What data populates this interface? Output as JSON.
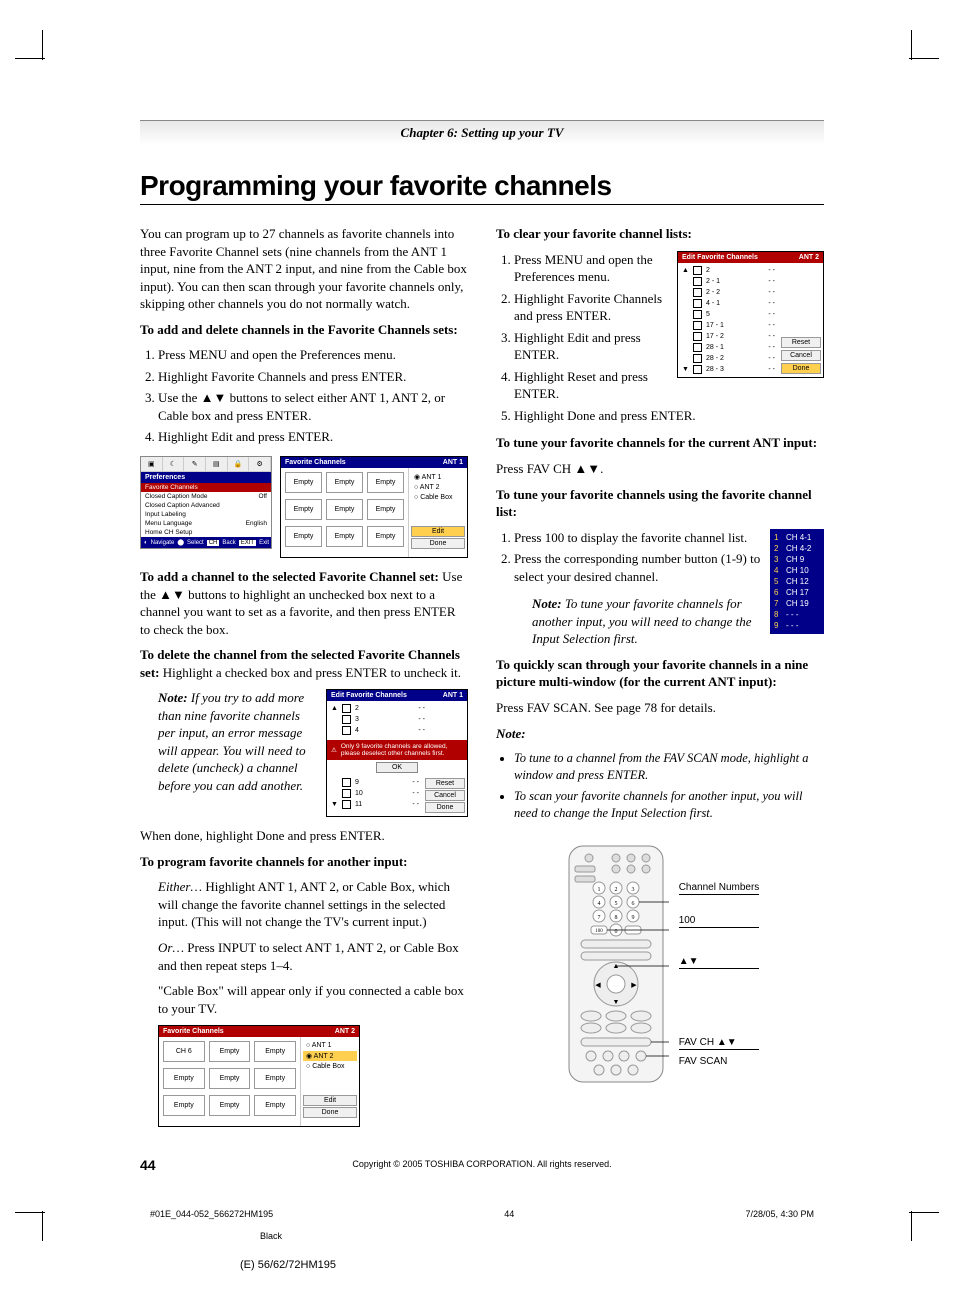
{
  "chapter": "Chapter 6: Setting up your TV",
  "title": "Programming your favorite channels",
  "intro": "You can program up to 27 channels as favorite channels into three Favorite Channel sets (nine channels from the ANT 1 input, nine from the ANT 2 input, and nine from the Cable box input). You can then scan through your favorite channels only, skipping other channels you do not normally watch.",
  "h_add_delete": "To add and delete channels in the Favorite Channels sets:",
  "steps1": {
    "s1": "Press MENU and open the Preferences menu.",
    "s2": "Highlight Favorite Channels and press ENTER.",
    "s3a": "Use the ",
    "s3b": " buttons to select either ANT 1, ANT 2, or Cable box and press ENTER.",
    "s4": "Highlight Edit and press ENTER."
  },
  "pref_panel": {
    "header": "Preferences",
    "sub": "Favorite Channels",
    "i1l": "Closed Caption Mode",
    "i1r": "Off",
    "i2": "Closed Caption Advanced",
    "i3": "Input Labeling",
    "i4l": "Menu Language",
    "i4r": "English",
    "i5": "Home CH Setup",
    "foot_nav": "Navigate",
    "foot_sel": "Select",
    "foot_back": "Back",
    "foot_exit": "Exit"
  },
  "fav_panel1": {
    "title": "Favorite Channels",
    "ant": "ANT 1",
    "empty": "Empty",
    "ant1": "ANT 1",
    "ant2": "ANT 2",
    "cable": "Cable Box",
    "edit": "Edit",
    "done": "Done"
  },
  "p_add_a": "To add a channel to the selected Favorite Channel set:",
  "p_add_b": " Use the ",
  "p_add_c": " buttons to highlight an unchecked box next to a channel you want to set as a favorite, and then press ENTER to check the box.",
  "p_del_a": "To delete the channel from the selected Favorite Channels set:",
  "p_del_b": " Highlight a checked box and press ENTER to uncheck it.",
  "note1_label": "Note:",
  "note1": " If you try to add more than nine favorite channels per input, an error message will appear. You will need to delete (uncheck) a channel before you can add another.",
  "edit_panel1": {
    "title": "Edit Favorite Channels",
    "ant": "ANT 1",
    "r1": "2",
    "r2": "3",
    "r3": "4",
    "warn": "Only 9 favorite channels are allowed, please deselect other channels first.",
    "ok": "OK",
    "r4": "9",
    "r5": "10",
    "r6": "11",
    "reset": "Reset",
    "cancel": "Cancel",
    "done": "Done",
    "dots": "- -"
  },
  "p_done": "When done, highlight Done and press ENTER.",
  "h_another": "To program favorite channels for another input:",
  "either_a": "Either…",
  "either_b": " Highlight ANT 1, ANT 2, or Cable Box, which will change the favorite channel settings in the selected input. (This will not change the TV's current input.)",
  "or_a": "Or…",
  "or_b": " Press INPUT to select ANT 1, ANT 2, or Cable Box and then repeat steps 1–4.",
  "cable_note": "\"Cable Box\" will appear only if you connected a cable box to your TV.",
  "fav_panel2": {
    "title": "Favorite Channels",
    "ant": "ANT 2",
    "ch6": "CH 6",
    "empty": "Empty",
    "ant1": "ANT 1",
    "ant2": "ANT 2",
    "cable": "Cable Box",
    "edit": "Edit",
    "done": "Done"
  },
  "h_clear": "To clear your favorite channel lists:",
  "steps2": {
    "s1": "Press MENU and open the Preferences menu.",
    "s2": "Highlight Favorite Channels and press ENTER.",
    "s3": "Highlight Edit and press ENTER.",
    "s4": "Highlight Reset and press ENTER.",
    "s5": "Highlight Done and press ENTER."
  },
  "edit_panel2": {
    "title": "Edit Favorite Channels",
    "ant": "ANT 2",
    "rows": [
      "2",
      "2 - 1",
      "2 - 2",
      "4 - 1",
      "5",
      "17 - 1",
      "17 - 2",
      "28 - 1",
      "28 - 2",
      "28 - 3"
    ],
    "dots": "- -",
    "reset": "Reset",
    "cancel": "Cancel",
    "done": "Done"
  },
  "h_tune_cur": "To tune your favorite channels for the current ANT input:",
  "p_favch_a": "Press FAV CH ",
  "p_favch_b": ".",
  "h_tune_list": "To tune your favorite channels using the favorite channel list:",
  "steps3": {
    "s1": "Press 100 to display the favorite channel list.",
    "s2": "Press the corresponding number button (1-9) to select your desired channel."
  },
  "note2_label": "Note:",
  "note2": " To tune your favorite channels for another input, you will need to change the Input Selection first.",
  "favlist": {
    "r1": "CH 4-1",
    "r2": "CH 4-2",
    "r3": "CH 9",
    "r4": "CH 10",
    "r5": "CH 12",
    "r6": "CH 17",
    "r7": "CH 19",
    "r8": "- - -",
    "r9": "- - -"
  },
  "h_scan": "To quickly scan through your favorite channels in a nine picture multi-window (for the current ANT input):",
  "p_scan": "Press FAV SCAN. See page 78 for details.",
  "note3_label": "Note:",
  "bullet1": "To tune to a channel from the FAV SCAN mode, highlight a window and press ENTER.",
  "bullet2": "To scan your favorite channels for another input, you will need to change the Input Selection first.",
  "remote": {
    "l1": "Channel Numbers",
    "l2": "100",
    "l3": "▲▼",
    "l4": "FAV CH ▲▼",
    "l5": "FAV SCAN"
  },
  "copyright": "Copyright © 2005 TOSHIBA CORPORATION. All rights reserved.",
  "pgnum": "44",
  "footfile": "#01E_044-052_566272HM195",
  "footpg": "44",
  "footdate": "7/28/05, 4:30 PM",
  "black": "Black",
  "model": "(E) 56/62/72HM195",
  "tri_up": "▲",
  "tri_dn": "▼",
  "tri_ud": "▲▼"
}
